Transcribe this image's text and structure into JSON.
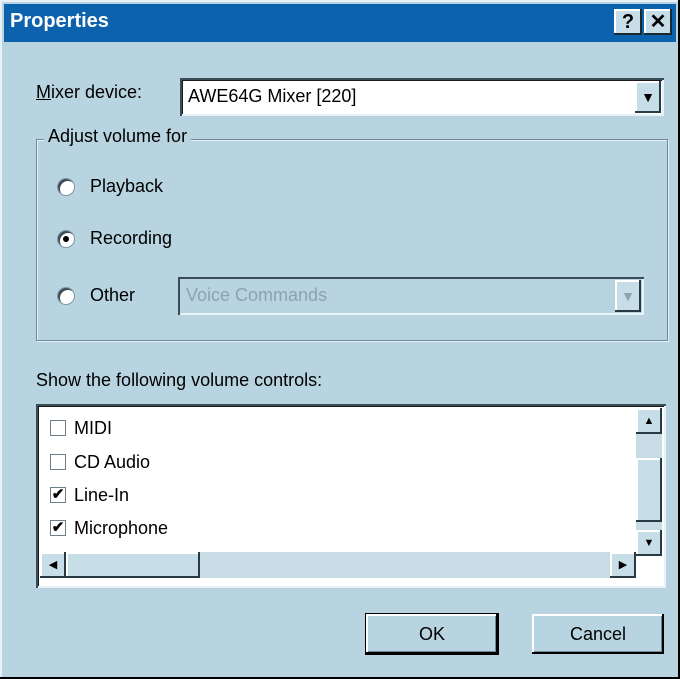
{
  "window": {
    "title": "Properties",
    "help_button": "?",
    "close_button": "✕"
  },
  "mixer": {
    "label_prefix": "M",
    "label_rest": "ixer device:",
    "value": "AWE64G Mixer [220]"
  },
  "adjust_volume": {
    "group_label": "Adjust volume for",
    "options": [
      {
        "label": "Playback",
        "selected": false
      },
      {
        "label": "Recording",
        "selected": true
      },
      {
        "label": "Other",
        "selected": false
      }
    ],
    "other_value": "Voice Commands"
  },
  "controls": {
    "heading": "Show the following volume controls:",
    "items": [
      {
        "label": "MIDI",
        "checked": false
      },
      {
        "label": "CD Audio",
        "checked": false
      },
      {
        "label": "Line-In",
        "checked": true
      },
      {
        "label": "Microphone",
        "checked": true
      }
    ]
  },
  "buttons": {
    "ok": "OK",
    "cancel": "Cancel"
  },
  "icons": {
    "dropdown": "▼",
    "scroll_up": "▲",
    "scroll_down": "▼",
    "scroll_left": "◀",
    "scroll_right": "▶",
    "check": "✔"
  }
}
